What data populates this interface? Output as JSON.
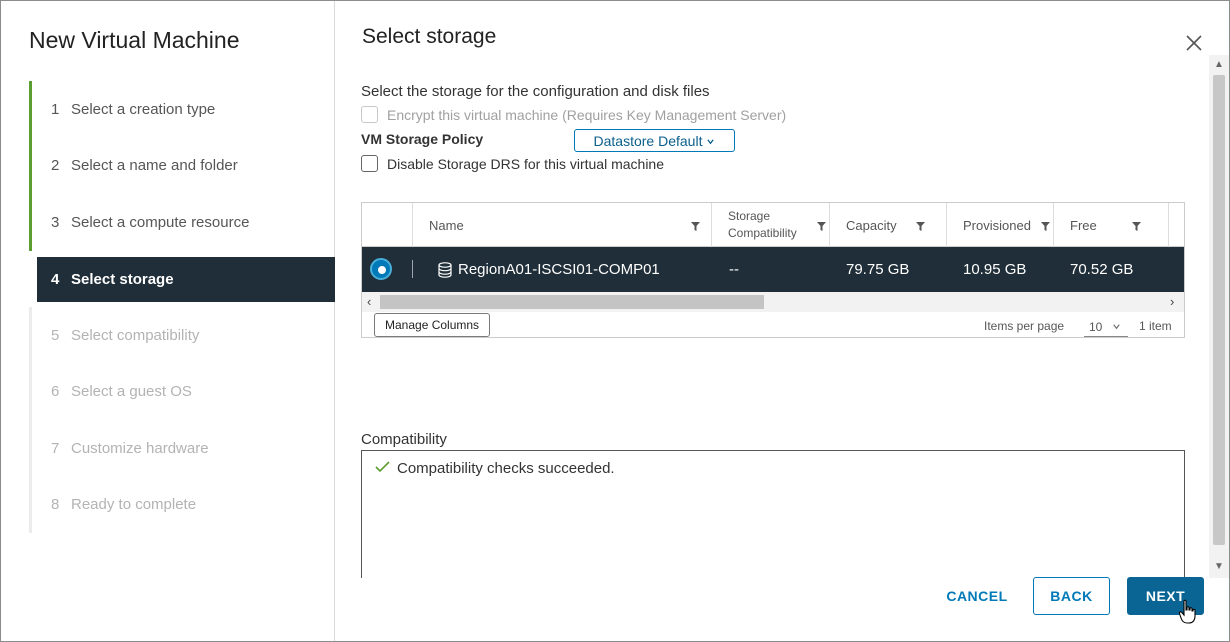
{
  "sidebar": {
    "title": "New Virtual Machine",
    "steps": [
      {
        "num": "1",
        "label": "Select a creation type",
        "state": "done"
      },
      {
        "num": "2",
        "label": "Select a name and folder",
        "state": "done"
      },
      {
        "num": "3",
        "label": "Select a compute resource",
        "state": "done"
      },
      {
        "num": "4",
        "label": "Select storage",
        "state": "active"
      },
      {
        "num": "5",
        "label": "Select compatibility",
        "state": "upcoming"
      },
      {
        "num": "6",
        "label": "Select a guest OS",
        "state": "upcoming"
      },
      {
        "num": "7",
        "label": "Customize hardware",
        "state": "upcoming"
      },
      {
        "num": "8",
        "label": "Ready to complete",
        "state": "upcoming"
      }
    ]
  },
  "main": {
    "title": "Select storage",
    "intro": "Select the storage for the configuration and disk files",
    "encrypt_label": "Encrypt this virtual machine (Requires Key Management Server)",
    "policy_label": "VM Storage Policy",
    "policy_value": "Datastore Default",
    "disable_drs_label": "Disable Storage DRS for this virtual machine"
  },
  "grid": {
    "columns": {
      "name": "Name",
      "storage_compat_line1": "Storage",
      "storage_compat_line2": "Compatibility",
      "capacity": "Capacity",
      "provisioned": "Provisioned",
      "free": "Free"
    },
    "rows": [
      {
        "name": "RegionA01-ISCSI01-COMP01",
        "compat": "--",
        "capacity": "79.75 GB",
        "provisioned": "10.95 GB",
        "free": "70.52 GB"
      }
    ],
    "manage_columns": "Manage Columns",
    "items_per_page_label": "Items per page",
    "items_per_page_value": "10",
    "item_count": "1 item"
  },
  "compatibility": {
    "label": "Compatibility",
    "message": "Compatibility checks succeeded."
  },
  "buttons": {
    "cancel": "CANCEL",
    "back": "BACK",
    "next": "NEXT"
  },
  "colors": {
    "accent": "#0079b8",
    "selected_row": "#1f2e38",
    "done_step": "#5c9e2f",
    "success": "#5c9e2f"
  }
}
